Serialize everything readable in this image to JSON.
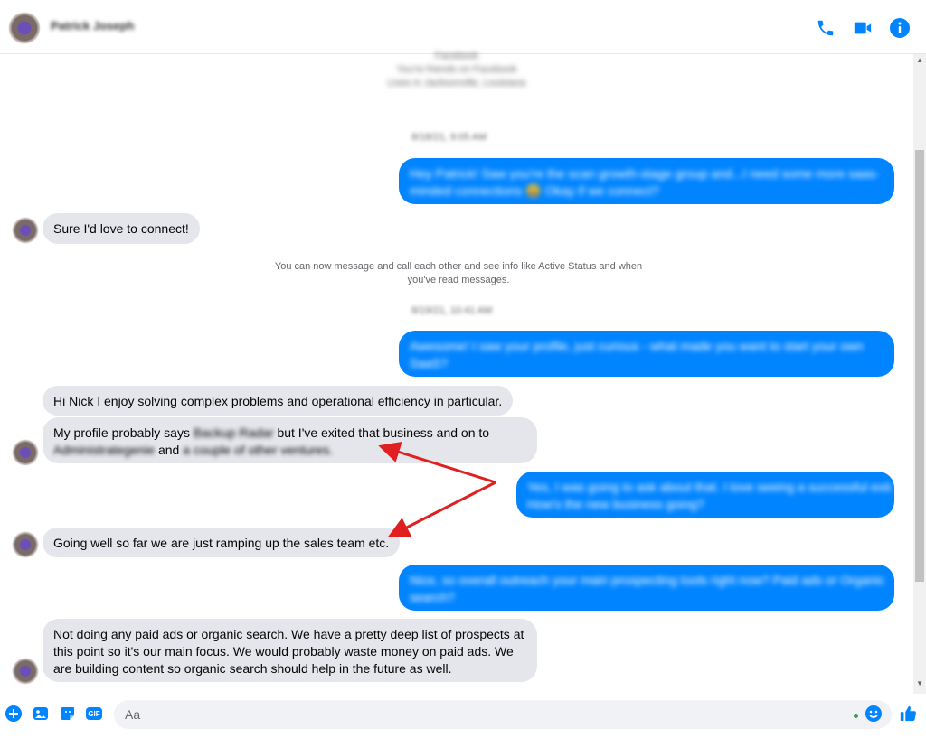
{
  "header": {
    "contact_name": "Patrick Joseph"
  },
  "intro": {
    "line1": "Facebook",
    "line2": "You're friends on Facebook",
    "line3": "Lives in Jacksonville, Louisiana"
  },
  "messages": [
    {
      "type": "stamp",
      "text": "8/18/21, 9:05 AM"
    },
    {
      "type": "outgoing",
      "lines": [
        "Hey Patrick! Saw you're the scan growth-stage group and...I need some more saas-",
        "minded connections 😃 Okay if we connect?"
      ]
    },
    {
      "type": "incoming",
      "lines": [
        "Sure I'd love to connect!"
      ]
    },
    {
      "type": "system",
      "lines": [
        "You can now message and call each other and see info like Active Status and when",
        "you've read messages."
      ]
    },
    {
      "type": "stamp",
      "text": "8/19/21, 10:41 AM"
    },
    {
      "type": "outgoing",
      "lines": [
        "Awesome! I saw your profile, just curious - what made you want to start your own",
        "SaaS?"
      ]
    },
    {
      "type": "incoming",
      "lines": [
        "Hi Nick I enjoy solving complex problems and operational efficiency in particular."
      ]
    },
    {
      "type": "incoming",
      "parts": {
        "p1": "My profile probably says ",
        "b1": "Backup Radar",
        "p2": " but I've exited that business and on to",
        "b2": "Administrategenie",
        "p3": " and ",
        "b3": "a couple of other ventures."
      }
    },
    {
      "type": "outgoing",
      "lines": [
        "Yes, I was going to ask about that. I love seeing a successful exit.",
        "How's the new business going?"
      ]
    },
    {
      "type": "incoming",
      "lines": [
        "Going well so far we are just ramping up the sales team etc."
      ]
    },
    {
      "type": "outgoing",
      "lines": [
        "Nice, so overall outreach your main prospecting tools right now? Paid ads or Organic",
        "search?"
      ]
    },
    {
      "type": "incoming",
      "lines": [
        "Not doing any paid ads or organic search. We have a pretty deep list of prospects at",
        "this point so it's our main focus. We would probably waste money on paid ads. We",
        "are building content so organic search should help in the future as well."
      ]
    }
  ],
  "composer": {
    "placeholder": "Aa",
    "gif_label": "GIF"
  },
  "icons": {
    "header": [
      "phone-icon",
      "video-camera-icon",
      "info-icon"
    ],
    "composer": [
      "plus-icon",
      "image-icon",
      "sticker-icon",
      "gif-icon",
      "emoji-icon",
      "thumbs-up-icon"
    ]
  },
  "colors": {
    "accent": "#0084ff",
    "incoming_bubble": "#e4e6eb",
    "annotation_arrow": "#e02020"
  }
}
